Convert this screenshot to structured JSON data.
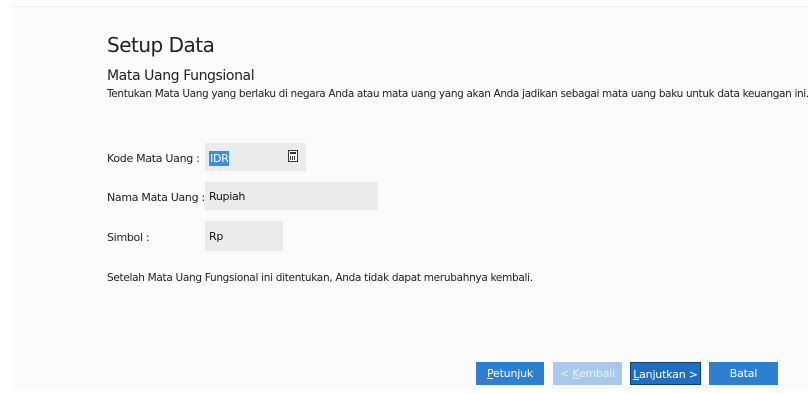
{
  "page": {
    "title": "Setup Data",
    "section_title": "Mata Uang Fungsional",
    "description": "Tentukan Mata Uang yang berlaku di negara Anda atau mata uang yang akan Anda jadikan sebagai mata uang baku untuk data keuangan ini."
  },
  "form": {
    "kode_label": "Kode Mata Uang :",
    "kode_value": "IDR",
    "nama_label": "Nama Mata Uang :",
    "nama_value": "Rupiah",
    "simbol_label": "Simbol :",
    "simbol_value": "Rp"
  },
  "note": "Setelah Mata Uang Fungsional ini ditentukan, Anda tidak dapat merubahnya kembali.",
  "buttons": {
    "petunjuk": {
      "accel": "P",
      "rest": "etunjuk"
    },
    "kembali": {
      "pre": "< ",
      "accel": "K",
      "rest": "embali"
    },
    "lanjutkan": {
      "accel": "L",
      "rest": "anjutkan >"
    },
    "batal": "Batal"
  },
  "colors": {
    "accent": "#2f7fd0",
    "disabled": "#a9c9ea",
    "field_bg": "#ebebeb",
    "selection": "#3d8ee0"
  },
  "icons": {
    "lookup": "calculator-icon"
  }
}
